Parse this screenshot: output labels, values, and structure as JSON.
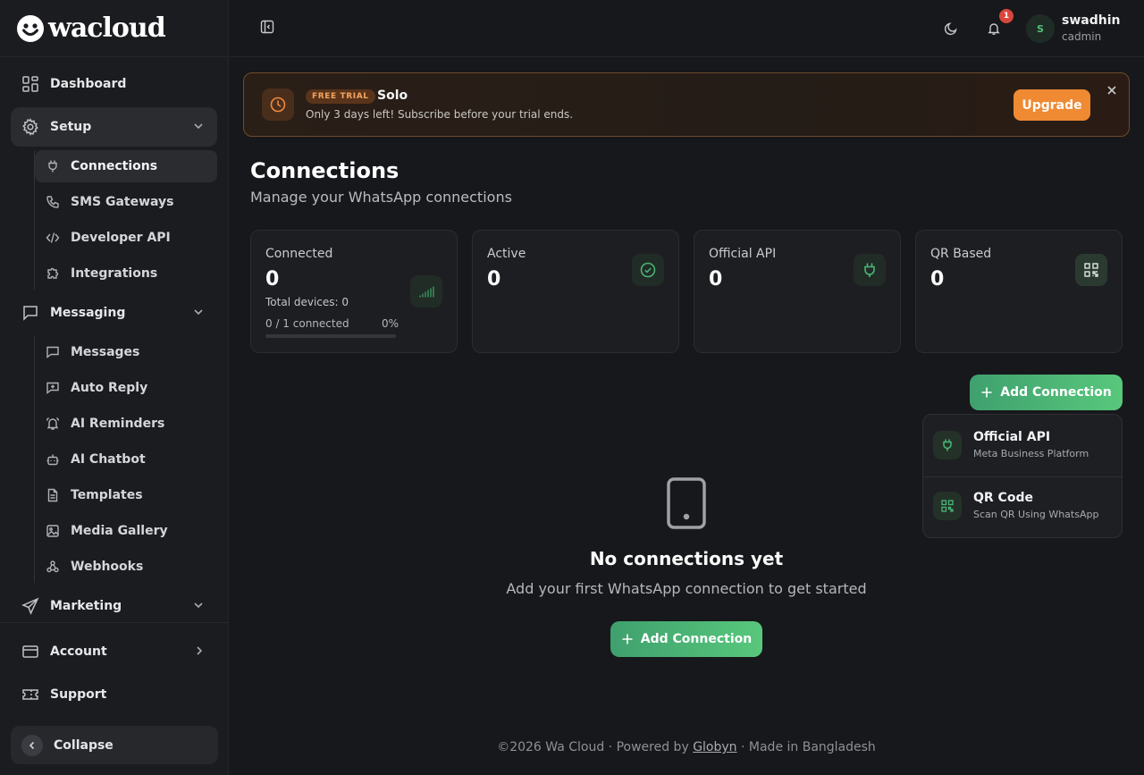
{
  "brand": {
    "name": "wacloud"
  },
  "sidebar": {
    "items": [
      {
        "label": "Dashboard"
      },
      {
        "label": "Setup"
      },
      {
        "label": "Messaging"
      },
      {
        "label": "Marketing"
      }
    ],
    "setup_sub": [
      {
        "label": "Connections"
      },
      {
        "label": "SMS Gateways"
      },
      {
        "label": "Developer API"
      },
      {
        "label": "Integrations"
      }
    ],
    "messaging_sub": [
      {
        "label": "Messages"
      },
      {
        "label": "Auto Reply"
      },
      {
        "label": "AI Reminders"
      },
      {
        "label": "AI Chatbot"
      },
      {
        "label": "Templates"
      },
      {
        "label": "Media Gallery"
      },
      {
        "label": "Webhooks"
      }
    ],
    "bottom": [
      {
        "label": "Account"
      },
      {
        "label": "Support"
      }
    ],
    "collapse_label": "Collapse"
  },
  "header": {
    "notification_count": "1",
    "user": {
      "initial": "S",
      "name": "swadhin",
      "role": "cadmin"
    }
  },
  "trial": {
    "badge": "FREE TRIAL",
    "plan": "Solo",
    "message": "Only 3 days left! Subscribe before your trial ends.",
    "upgrade_label": "Upgrade"
  },
  "page": {
    "title": "Connections",
    "subtitle": "Manage your WhatsApp connections"
  },
  "stats": [
    {
      "label": "Connected",
      "value": "0",
      "total_devices": "Total devices: 0",
      "connected_ratio": "0 / 1 connected",
      "percent": "0%",
      "progress": 0
    },
    {
      "label": "Active",
      "value": "0"
    },
    {
      "label": "Official API",
      "value": "0"
    },
    {
      "label": "QR Based",
      "value": "0"
    }
  ],
  "add_connection": {
    "label": "Add Connection",
    "menu": [
      {
        "title": "Official API",
        "desc": "Meta Business Platform",
        "icon": "plug-icon"
      },
      {
        "title": "QR Code",
        "desc": "Scan QR Using WhatsApp",
        "icon": "qr-code-icon"
      }
    ]
  },
  "empty_state": {
    "title": "No connections yet",
    "message": "Add your first WhatsApp connection to get started",
    "button_label": "Add Connection"
  },
  "footer": {
    "prefix": "©2026 Wa Cloud · Powered by ",
    "link": "Globyn",
    "suffix": " · Made in Bangladesh"
  },
  "colors": {
    "accent_green": "#4bb97a",
    "trial_orange": "#ef8a33",
    "badge_red": "#d9463b"
  }
}
